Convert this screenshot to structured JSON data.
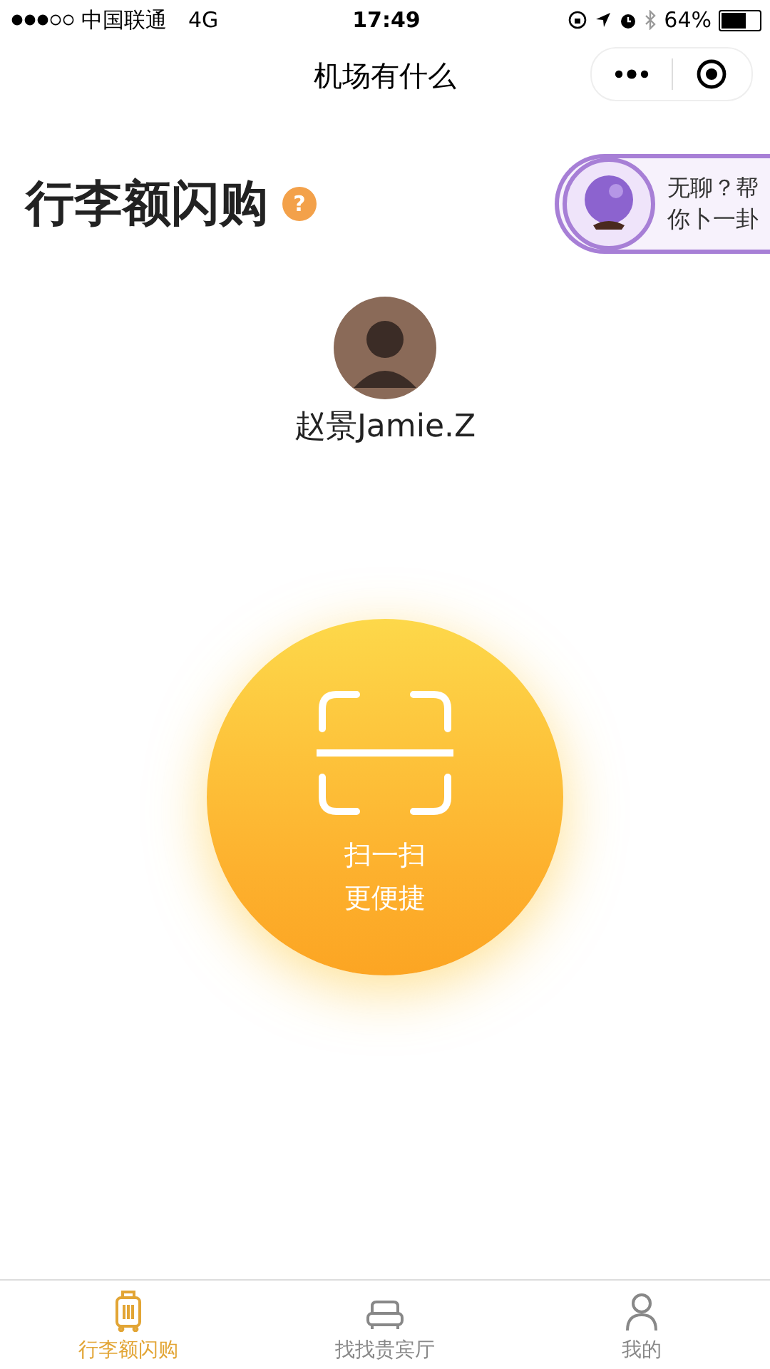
{
  "status_bar": {
    "carrier": "中国联通",
    "network": "4G",
    "time": "17:49",
    "battery": "64%"
  },
  "nav": {
    "title": "机场有什么"
  },
  "header": {
    "title": "行李额闪购",
    "help": "?"
  },
  "fortune": {
    "lines": [
      "无聊？帮",
      "你卜一卦"
    ]
  },
  "user": {
    "name": "赵景Jamie.Z"
  },
  "scan": {
    "lines": [
      "扫一扫",
      "更便捷"
    ]
  },
  "tabs": [
    {
      "kind": "luggage",
      "label": "行李额闪购",
      "selected": true
    },
    {
      "kind": "lounge",
      "label": "找找贵宾厅",
      "selected": false
    },
    {
      "kind": "profile",
      "label": "我的",
      "selected": false
    }
  ]
}
